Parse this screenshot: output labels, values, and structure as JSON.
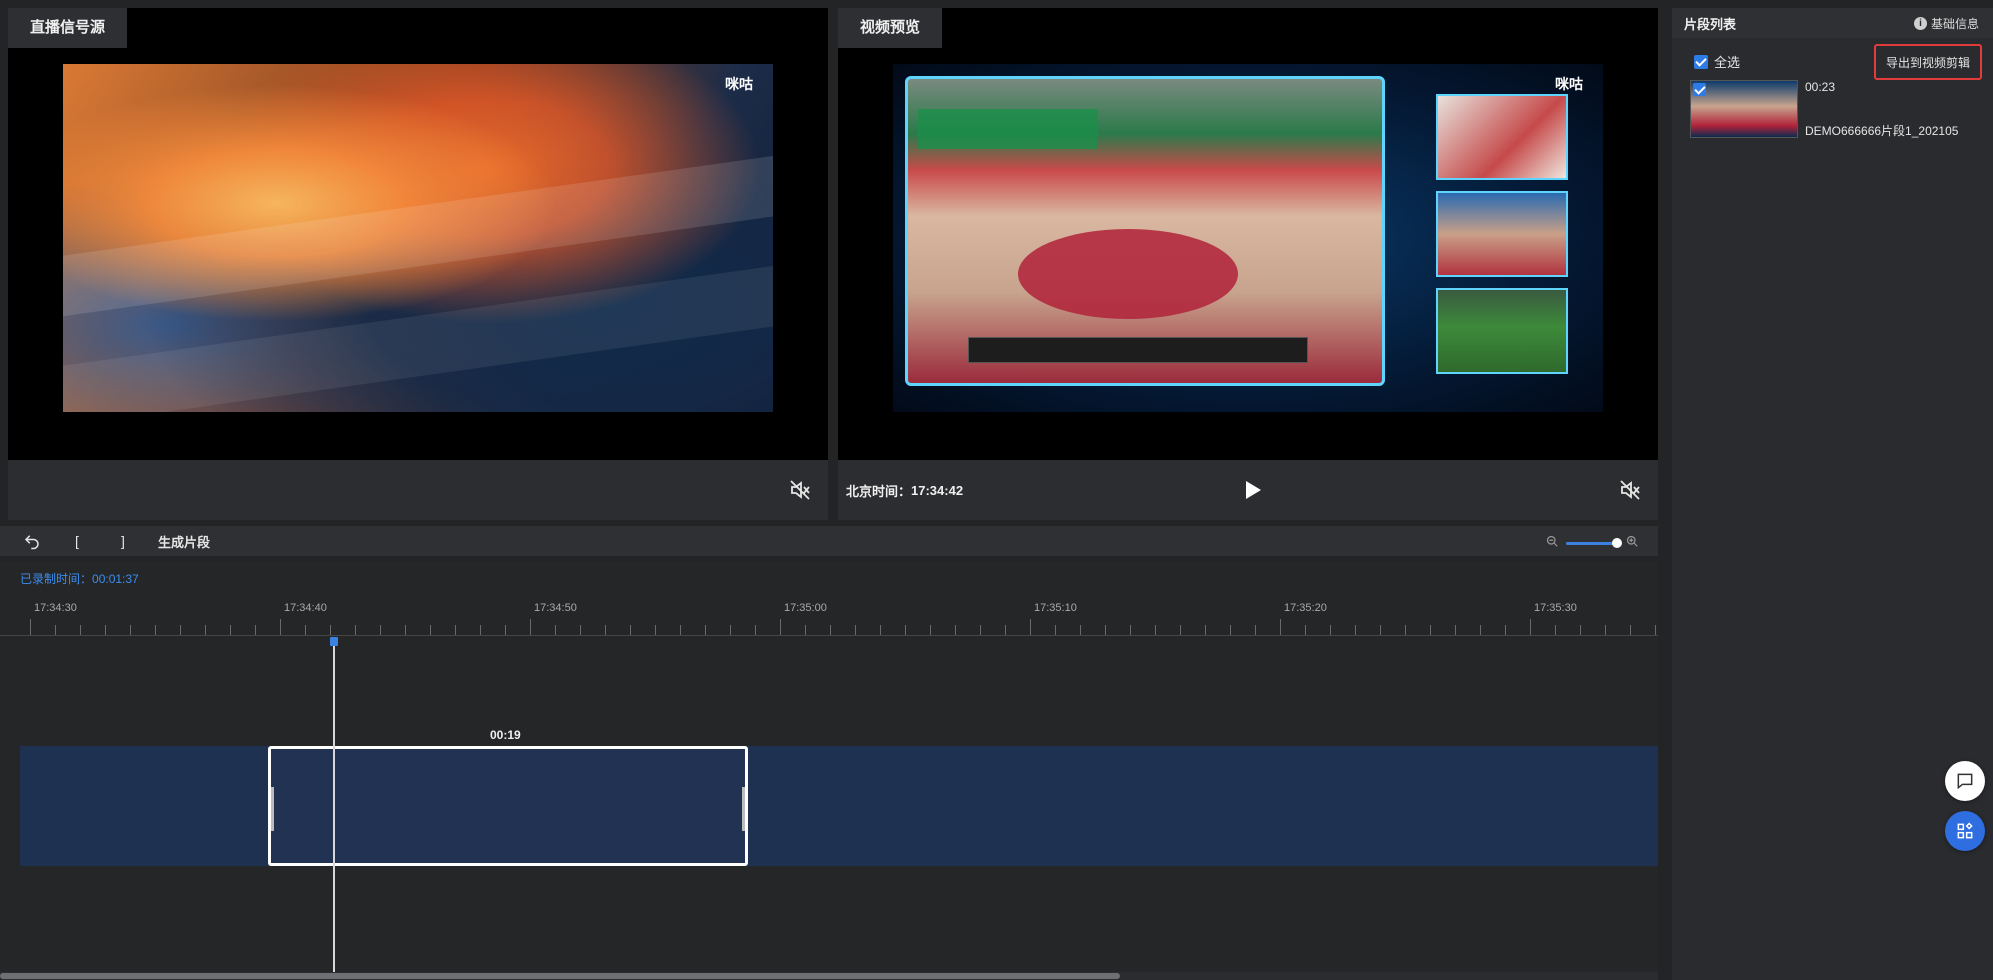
{
  "live_panel": {
    "title": "直播信号源",
    "watermark": "咪咕",
    "mute_icon": "mute-speaker-icon"
  },
  "preview_panel": {
    "title": "视频预览",
    "watermark": "咪咕",
    "clock_label": "北京时间：",
    "clock_value": "17:34:42",
    "play_icon": "play-icon",
    "mute_icon": "mute-speaker-icon"
  },
  "toolbar": {
    "undo_icon": "undo-icon",
    "mark_in": "[",
    "mark_out": "]",
    "generate_label": "生成片段",
    "zoom_out_icon": "zoom-out-icon",
    "zoom_in_icon": "zoom-in-icon",
    "zoom_level": 1.0
  },
  "timeline": {
    "recorded_label": "已录制时间：",
    "recorded_value": "00:01:37",
    "ticks": [
      "17:34:30",
      "17:34:40",
      "17:34:50",
      "17:35:00",
      "17:35:10",
      "17:35:20",
      "17:35:30"
    ],
    "clip_duration": "00:19",
    "playhead_time": "17:34:42"
  },
  "sidebar": {
    "title": "片段列表",
    "info_label": "基础信息",
    "select_all_label": "全选",
    "select_all_checked": true,
    "export_label": "导出到视频剪辑",
    "clips": [
      {
        "duration": "00:23",
        "name": "DEMO666666片段1_202105",
        "checked": true
      }
    ]
  },
  "floating": {
    "chat_icon": "chat-bubble-icon",
    "apps_icon": "apps-grid-icon"
  },
  "colors": {
    "accent": "#2f7be5",
    "export_border": "#e23b3b",
    "track": "#1f3150"
  }
}
